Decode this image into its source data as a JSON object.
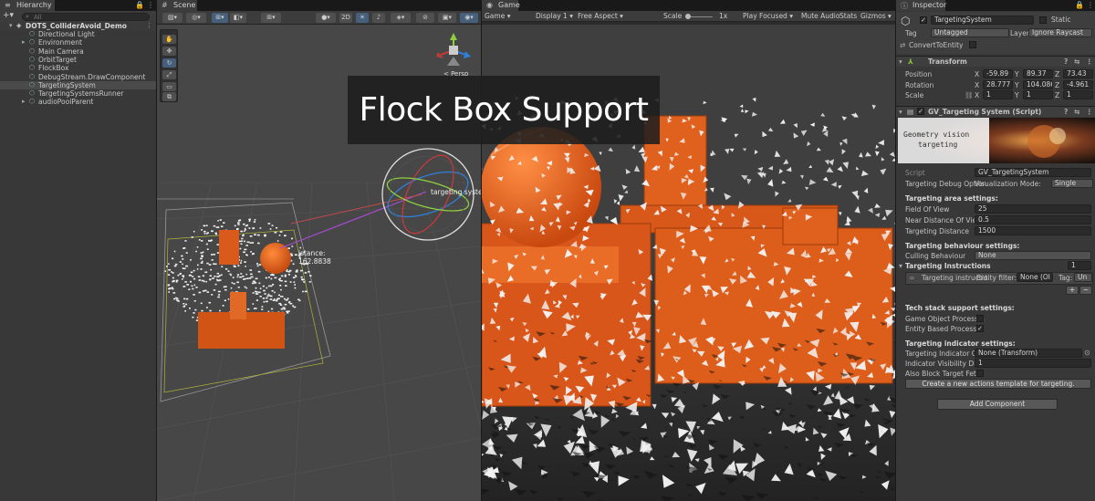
{
  "hierarchy": {
    "tab": "Hierarchy",
    "search_placeholder": "All",
    "scene_name": "DOTS_ColliderAvoid_Demo",
    "items": [
      {
        "label": "Directional Light"
      },
      {
        "label": "Environment"
      },
      {
        "label": "Main Camera"
      },
      {
        "label": "OrbitTarget"
      },
      {
        "label": "FlockBox"
      },
      {
        "label": "DebugStream.DrawComponent"
      },
      {
        "label": "TargetingSystem",
        "selected": true
      },
      {
        "label": "TargetingSystemsRunner"
      },
      {
        "label": "audioPoolParent"
      }
    ]
  },
  "scene": {
    "tab": "Scene",
    "mode_2d": "2D",
    "persp_label": "< Persp",
    "targeting_label": "targeting system",
    "distance_label": "istance:",
    "distance_value": "162.8838"
  },
  "game": {
    "tab": "Game",
    "mode": "Game",
    "display": "Display 1",
    "aspect": "Free Aspect",
    "scale_label": "Scale",
    "scale_value": "1x",
    "play_focused": "Play Focused",
    "mute": "Mute Audio",
    "stats": "Stats",
    "gizmos": "Gizmos"
  },
  "banner": {
    "text": "Flock Box Support"
  },
  "inspector": {
    "tab": "Inspector",
    "object_name": "TargetingSystem",
    "static_label": "Static",
    "tag_label": "Tag",
    "tag_value": "Untagged",
    "layer_label": "Layer",
    "layer_value": "Ignore Raycast",
    "convert_label": "ConvertToEntity",
    "transform": {
      "title": "Transform",
      "position_label": "Position",
      "rotation_label": "Rotation",
      "scale_label": "Scale",
      "position": {
        "x": "-59.89",
        "y": "89.37",
        "z": "73.43"
      },
      "rotation": {
        "x": "28.777",
        "y": "104.086",
        "z": "-4.961"
      },
      "scale": {
        "x": "1",
        "y": "1",
        "z": "1"
      }
    },
    "script_component": {
      "title": "GV_Targeting System (Script)",
      "banner_line1": "Geometry vision",
      "banner_line2": "targeting",
      "script_label": "Script",
      "script_value": "GV_TargetingSystem",
      "debug_label": "Targeting Debug Option",
      "vis_mode_label": "Visualization Mode:",
      "vis_mode_value": "Single",
      "area_header": "Targeting area settings:",
      "fov_label": "Field Of View",
      "fov_value": "25",
      "near_label": "Near Distance Of View",
      "near_value": "0.5",
      "dist_label": "Targeting Distance",
      "dist_value": "1500",
      "behaviour_header": "Targeting behaviour settings:",
      "culling_label": "Culling Behaviour",
      "culling_value": "None",
      "instructions_label": "Targeting Instructions",
      "instructions_count": "1",
      "instr_item": "Targeting instructio",
      "entity_filter_label": "Entity filter:",
      "entity_filter_value": "None (Ol",
      "tag_label": "Tag:",
      "tag_value": "Un",
      "add": "+",
      "remove": "−",
      "tech_header": "Tech stack support settings:",
      "go_processing_label": "Game Object Processin",
      "entity_processing_label": "Entity Based Processin",
      "indicator_header": "Targeting indicator settings:",
      "indicator_obj_label": "Targeting Indicator Obj",
      "indicator_obj_value": "None (Transform)",
      "visibility_label": "Indicator Visibility Dista",
      "visibility_value": "1",
      "block_label": "Also Block Target Fetch",
      "create_button": "Create a new actions template for targeting."
    },
    "add_component": "Add Component"
  }
}
